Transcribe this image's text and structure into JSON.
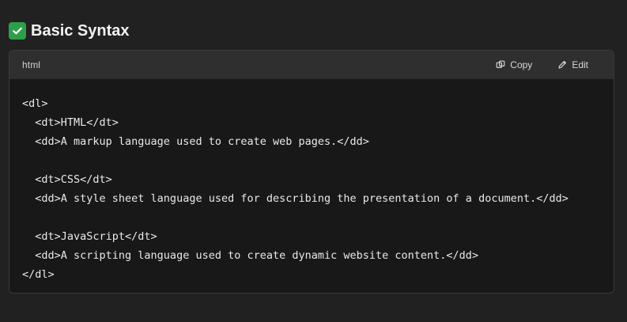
{
  "section": {
    "title": "Basic Syntax",
    "icon": "check-mark-icon",
    "icon_color": "#2e9e4a"
  },
  "code_block": {
    "language": "html",
    "actions": {
      "copy_label": "Copy",
      "edit_label": "Edit"
    },
    "lines": [
      "<dl>",
      "  <dt>HTML</dt>",
      "  <dd>A markup language used to create web pages.</dd>",
      "",
      "  <dt>CSS</dt>",
      "  <dd>A style sheet language used for describing the presentation of a document.</dd>",
      "",
      "  <dt>JavaScript</dt>",
      "  <dd>A scripting language used to create dynamic website content.</dd>",
      "</dl>"
    ]
  },
  "colors": {
    "page_background": "#212121",
    "code_background": "#181818",
    "header_background": "#2f2f2f"
  }
}
